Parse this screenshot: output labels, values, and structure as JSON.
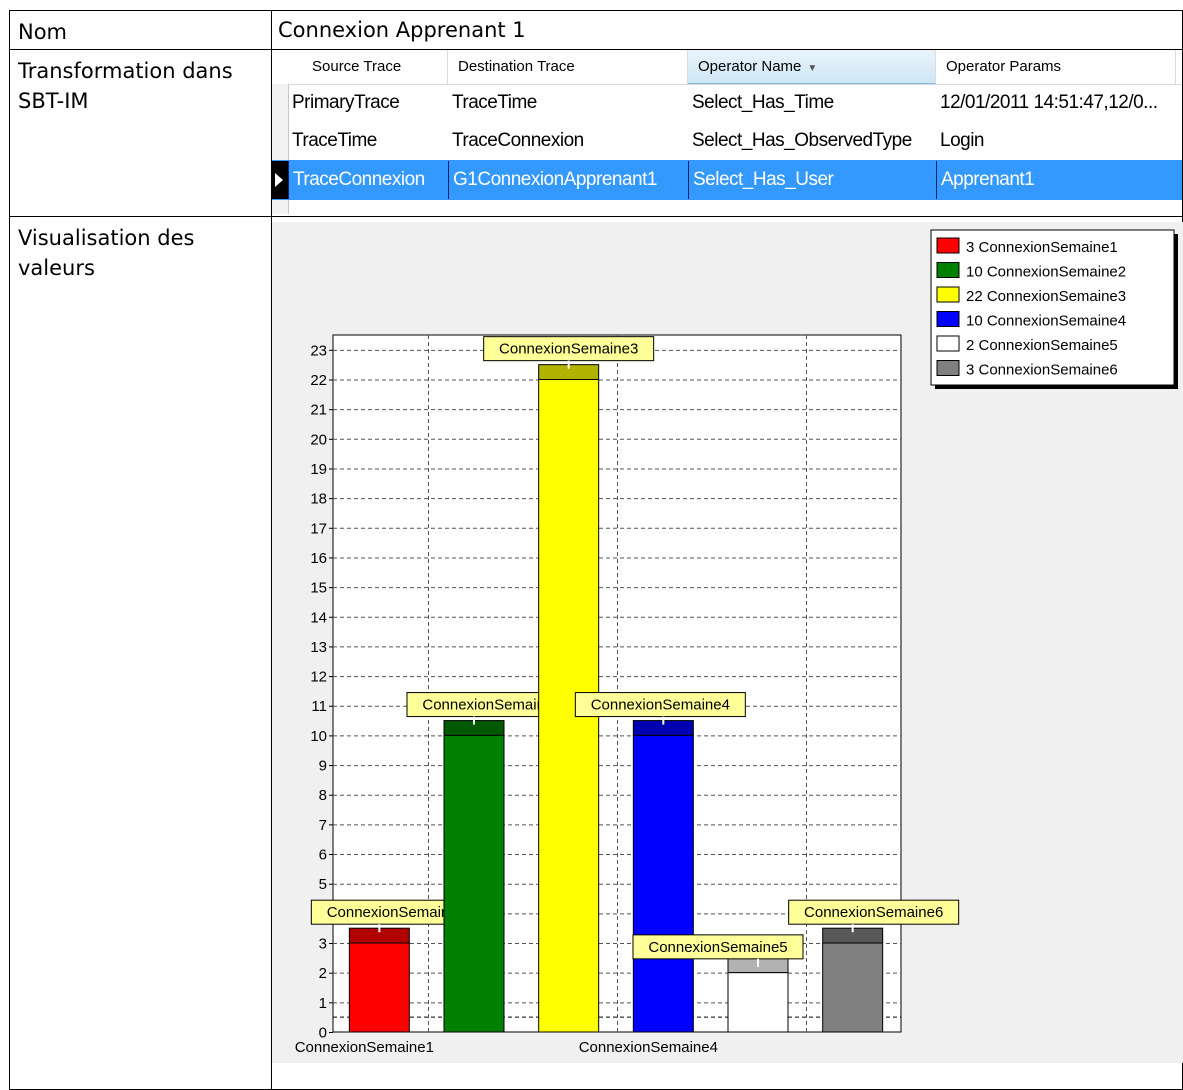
{
  "rows": {
    "nom_label": "Nom",
    "nom_value": "Connexion Apprenant 1",
    "transformation_label": "Transformation dans SBT-IM",
    "visualisation_label": "Visualisation des valeurs"
  },
  "grid": {
    "columns": [
      "Source Trace",
      "Destination Trace",
      "Operator Name",
      "Operator Params"
    ],
    "sorted_column": "Operator Name",
    "selection_color": "#3399ff",
    "rows": [
      [
        "PrimaryTrace",
        "TraceTime",
        "Select_Has_Time",
        "12/01/2011 14:51:47,12/0..."
      ],
      [
        "TraceTime",
        "TraceConnexion",
        "Select_Has_ObservedType",
        "Login"
      ],
      [
        "TraceConnexion",
        "G1ConnexionApprenant1",
        "Select_Has_User",
        "Apprenant1"
      ]
    ],
    "selected_row": 2
  },
  "chart_data": {
    "type": "bar",
    "categories": [
      "ConnexionSemaine1",
      "ConnexionSemaine2",
      "ConnexionSemaine3",
      "ConnexionSemaine4",
      "ConnexionSemaine5",
      "ConnexionSemaine6"
    ],
    "values": [
      3,
      10,
      22,
      10,
      2,
      3
    ],
    "colors": [
      "#ff0000",
      "#008000",
      "#ffff00",
      "#0000ff",
      "#ffffff",
      "#808080"
    ],
    "legend": [
      "3 ConnexionSemaine1",
      "10 ConnexionSemaine2",
      "22 ConnexionSemaine3",
      "10 ConnexionSemaine4",
      "2 ConnexionSemaine5",
      "3 ConnexionSemaine6"
    ],
    "legend_position": "top-right",
    "x_tick_labels": [
      "ConnexionSemaine1",
      "ConnexionSemaine4"
    ],
    "ylim": [
      0,
      23.5
    ],
    "yticks": [
      0,
      1,
      2,
      3,
      4,
      5,
      6,
      7,
      8,
      9,
      10,
      11,
      12,
      13,
      14,
      15,
      16,
      17,
      18,
      19,
      20,
      21,
      22,
      23
    ],
    "grid": true,
    "title": "",
    "xlabel": "",
    "ylabel": ""
  }
}
